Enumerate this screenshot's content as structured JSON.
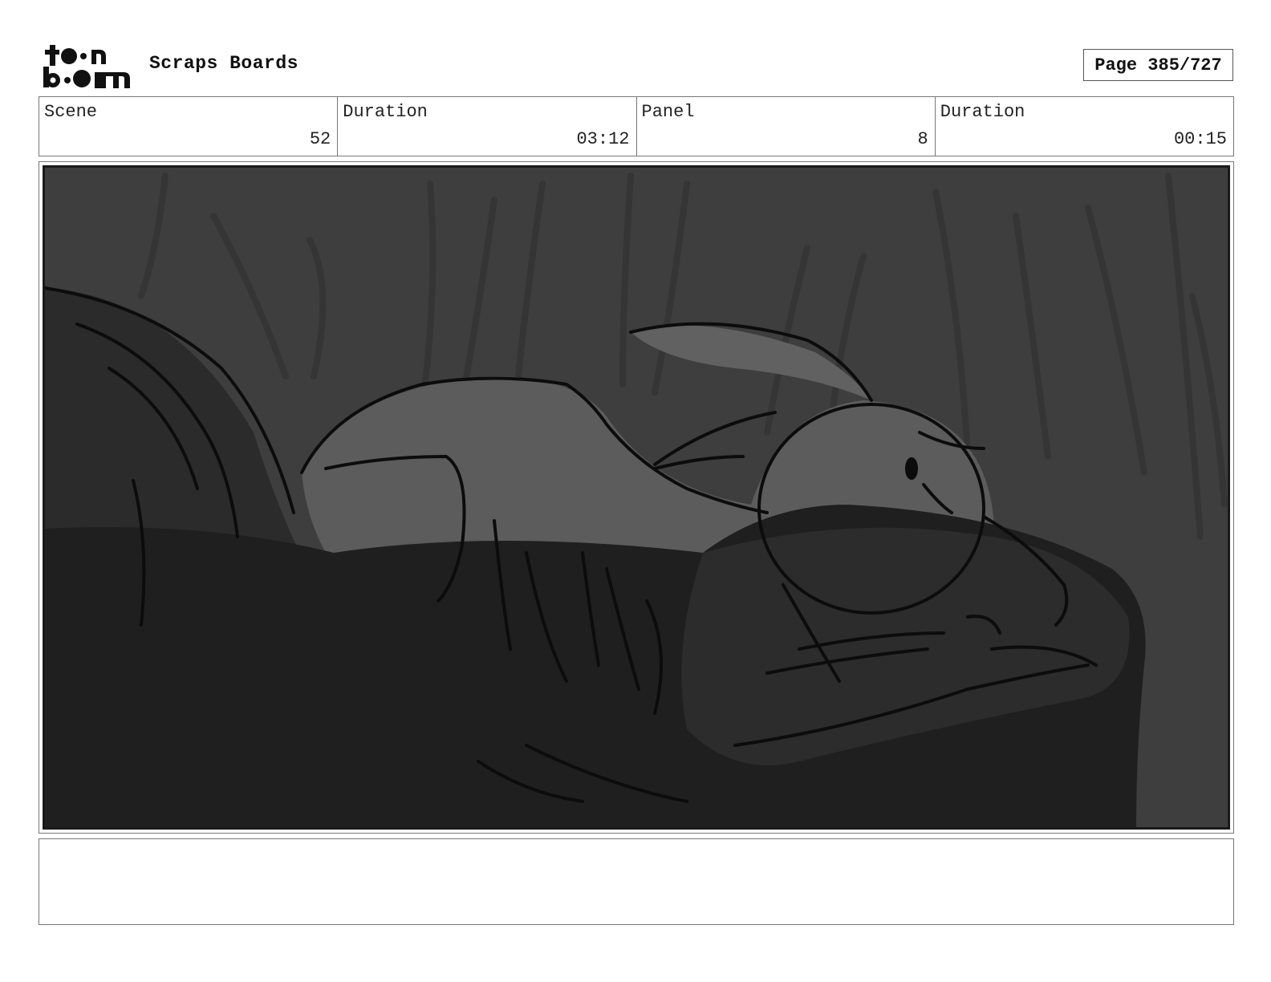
{
  "header": {
    "logo_icon": "toonboom-logo",
    "logo_text_top": "toon",
    "logo_text_bottom": "boom",
    "project_title": "Scraps Boards",
    "page_label": "Page 385/727"
  },
  "info_bar": {
    "scene_label": "Scene",
    "scene_value": "52",
    "scene_duration_label": "Duration",
    "scene_duration_value": "03:12",
    "panel_label": "Panel",
    "panel_value": "8",
    "panel_duration_label": "Duration",
    "panel_duration_value": "00:15"
  },
  "panel": {
    "image_icon": "storyboard-sketch-sleeping-rabbit"
  },
  "notes": {
    "text": ""
  }
}
